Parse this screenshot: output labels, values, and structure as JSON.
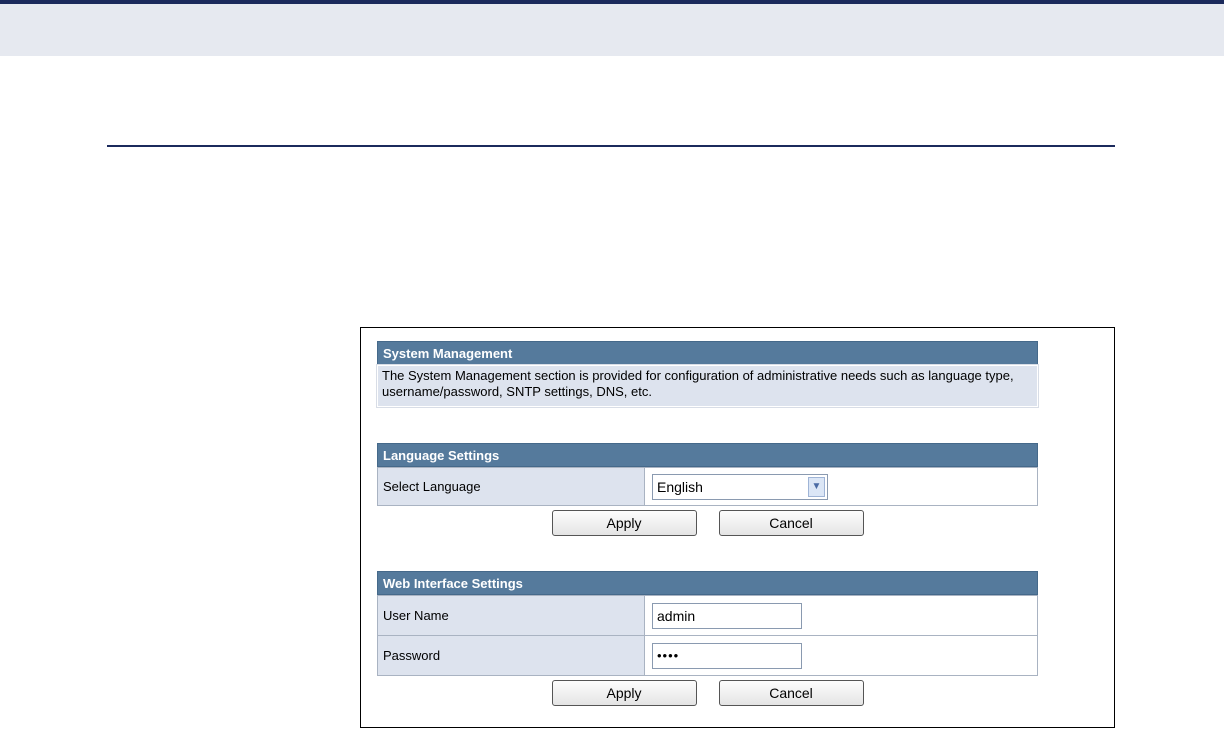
{
  "system_management": {
    "title": "System Management",
    "description": "The System Management section is provided for configuration of administrative needs such as language type, username/password, SNTP settings, DNS, etc."
  },
  "language_settings": {
    "title": "Language Settings",
    "select_label": "Select Language",
    "selected_value": "English",
    "apply_label": "Apply",
    "cancel_label": "Cancel"
  },
  "web_interface_settings": {
    "title": "Web Interface Settings",
    "username_label": "User Name",
    "username_value": "admin",
    "password_label": "Password",
    "password_value": "••••",
    "apply_label": "Apply",
    "cancel_label": "Cancel"
  }
}
